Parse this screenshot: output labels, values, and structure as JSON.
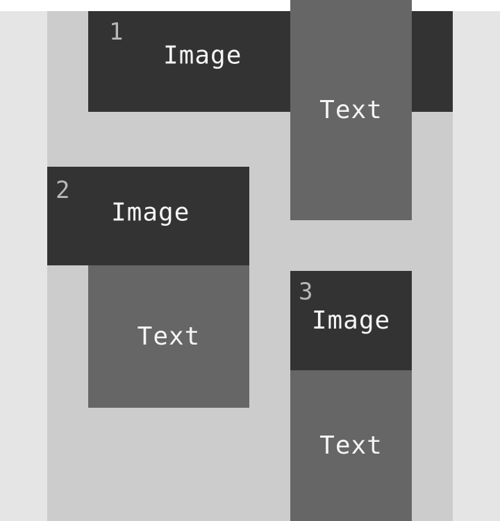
{
  "items": [
    {
      "number": "1",
      "image_label": "Image",
      "text_label": "Text"
    },
    {
      "number": "2",
      "image_label": "Image",
      "text_label": "Text"
    },
    {
      "number": "3",
      "image_label": "Image",
      "text_label": "Text"
    }
  ],
  "colors": {
    "image_block": "#333333",
    "text_block": "#666666",
    "canvas": "#cccccc",
    "side_band": "#e5e5e5",
    "number": "#b8b8b8"
  }
}
